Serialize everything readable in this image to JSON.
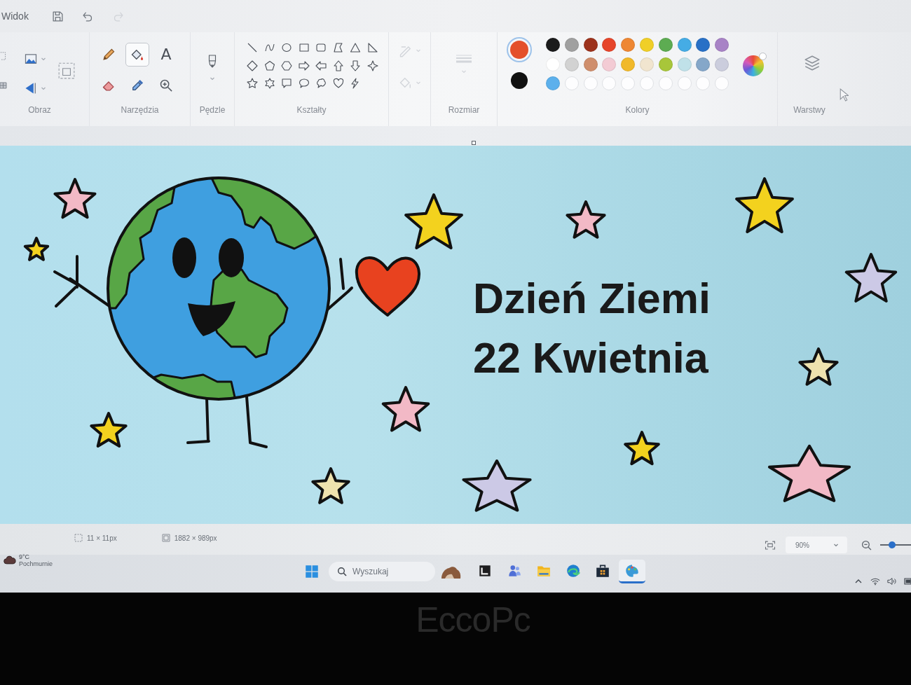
{
  "menu_bar": {
    "menu": "Widok",
    "quick_actions": [
      {
        "kind": "save",
        "disabled": false
      },
      {
        "kind": "undo",
        "disabled": false
      },
      {
        "kind": "redo",
        "disabled": true
      }
    ]
  },
  "ribbon": {
    "image": {
      "label": "Obraz"
    },
    "tools": {
      "label": "Narzędzia",
      "items": [
        {
          "kind": "pencil",
          "selected": false
        },
        {
          "kind": "fill",
          "selected": true
        },
        {
          "kind": "text",
          "glyph": "A",
          "selected": false
        },
        {
          "kind": "eraser",
          "selected": false
        },
        {
          "kind": "picker",
          "selected": false
        },
        {
          "kind": "magnifier",
          "selected": false
        }
      ]
    },
    "brushes": {
      "label": "Pędzle"
    },
    "shapes": {
      "label": "Kształty"
    },
    "shape_style": {
      "disabled": true
    },
    "size": {
      "label": "Rozmiar",
      "disabled": true
    },
    "colors": {
      "label": "Kolory",
      "current": [
        {
          "color": "#e4502a",
          "selected": true
        },
        {
          "color": "#111111",
          "selected": false
        }
      ],
      "palette": [
        {
          "kind": "swatch",
          "color": "#1b1b1b"
        },
        {
          "kind": "swatch",
          "color": "#a0a0a0"
        },
        {
          "kind": "swatch",
          "color": "#9c321c"
        },
        {
          "kind": "swatch",
          "color": "#e6452a"
        },
        {
          "kind": "swatch",
          "color": "#ee8733"
        },
        {
          "kind": "swatch",
          "color": "#f0cf27"
        },
        {
          "kind": "swatch",
          "color": "#5dac52"
        },
        {
          "kind": "swatch",
          "color": "#45ace5"
        },
        {
          "kind": "swatch",
          "color": "#2870c6"
        },
        {
          "kind": "swatch",
          "color": "#a883c6"
        },
        {
          "kind": "swatch",
          "color": "#ffffff"
        },
        {
          "kind": "swatch",
          "color": "#d2d2d2"
        },
        {
          "kind": "swatch",
          "color": "#cf8e6c"
        },
        {
          "kind": "swatch",
          "color": "#f3cbd4"
        },
        {
          "kind": "swatch",
          "color": "#f1b92a"
        },
        {
          "kind": "swatch",
          "color": "#f1e5cf"
        },
        {
          "kind": "swatch",
          "color": "#a8c63a"
        },
        {
          "kind": "swatch",
          "color": "#c0e1e9"
        },
        {
          "kind": "swatch",
          "color": "#85a7c9"
        },
        {
          "kind": "swatch",
          "color": "#cbcddd"
        },
        {
          "kind": "swatch",
          "color": "#5cb0ec"
        },
        {
          "kind": "empty"
        },
        {
          "kind": "empty"
        },
        {
          "kind": "empty"
        },
        {
          "kind": "empty"
        },
        {
          "kind": "empty"
        },
        {
          "kind": "empty"
        },
        {
          "kind": "empty"
        },
        {
          "kind": "empty"
        },
        {
          "kind": "empty"
        }
      ]
    },
    "layers": {
      "label": "Warstwy"
    }
  },
  "canvas": {
    "text_lines": [
      "Dzień Ziemi",
      "22 Kwietnia"
    ],
    "stars": [
      {
        "color": "#f2b9c6"
      },
      {
        "color": "#f3d21e"
      },
      {
        "color": "#f3d21e"
      },
      {
        "color": "#f2b9c6"
      },
      {
        "color": "#f3d21e"
      },
      {
        "color": "#ccc9e6"
      },
      {
        "color": "#eee2ae"
      },
      {
        "color": "#f2b9c6"
      },
      {
        "color": "#f3d21e"
      },
      {
        "color": "#eee2ae"
      },
      {
        "color": "#ccc9e6"
      },
      {
        "color": "#f3d21e"
      },
      {
        "color": "#f2b9c6"
      }
    ]
  },
  "status_bar": {
    "selection_size": "11 × 11px",
    "canvas_size": "1882 × 989px",
    "zoom": "90%",
    "zoom_slider": {
      "level": 0.35
    }
  },
  "taskbar": {
    "weather": {
      "temperature": "9°C",
      "condition": "Pochmurnie"
    },
    "search": {
      "placeholder": "Wyszukaj"
    },
    "apps": [
      {
        "kind": "tile",
        "active": false
      },
      {
        "kind": "people",
        "active": false
      },
      {
        "kind": "folder",
        "active": false
      },
      {
        "kind": "swirl",
        "active": false
      },
      {
        "kind": "bag",
        "active": false
      },
      {
        "kind": "palette",
        "active": true
      }
    ]
  },
  "monitor": {
    "brand": "EccoPc"
  }
}
